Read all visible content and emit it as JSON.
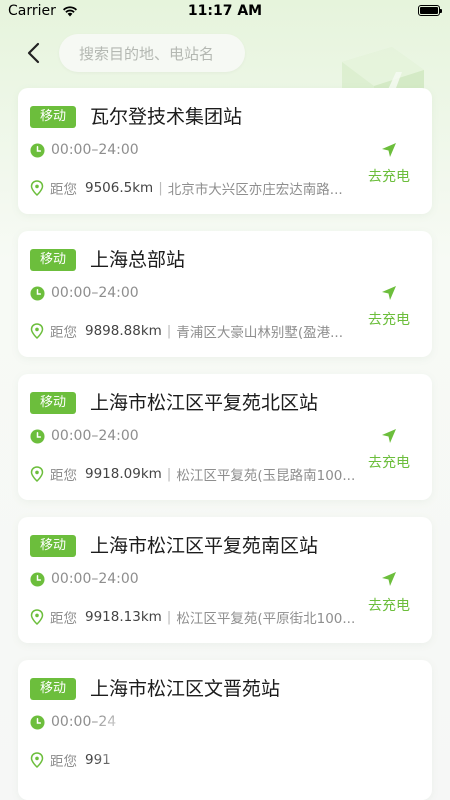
{
  "status_bar": {
    "carrier": "Carrier",
    "time": "11:17 AM"
  },
  "header": {
    "search_placeholder": "搜索目的地、电站名"
  },
  "stations": [
    {
      "tag": "移动",
      "name": "瓦尔登技术集团站",
      "hours": "00:00–24:00",
      "distance_label": "距您",
      "distance": "9506.5km",
      "address": "北京市大兴区亦庄宏达南路...",
      "action": "去充电"
    },
    {
      "tag": "移动",
      "name": "上海总部站",
      "hours": "00:00–24:00",
      "distance_label": "距您",
      "distance": "9898.88km",
      "address": "青浦区大豪山林别墅(盈港...",
      "action": "去充电"
    },
    {
      "tag": "移动",
      "name": "上海市松江区平复苑北区站",
      "hours": "00:00–24:00",
      "distance_label": "距您",
      "distance": "9918.09km",
      "address": "松江区平复苑(玉昆路南100...",
      "action": "去充电"
    },
    {
      "tag": "移动",
      "name": "上海市松江区平复苑南区站",
      "hours": "00:00–24:00",
      "distance_label": "距您",
      "distance": "9918.13km",
      "address": "松江区平复苑(平原街北100...",
      "action": "去充电"
    },
    {
      "tag": "移动",
      "name": "上海市松江区文晋苑站",
      "hours": "00:00–24",
      "distance_label": "距您",
      "distance": "991",
      "address": "",
      "action": ""
    }
  ],
  "colors": {
    "accent": "#6cbe3c"
  }
}
